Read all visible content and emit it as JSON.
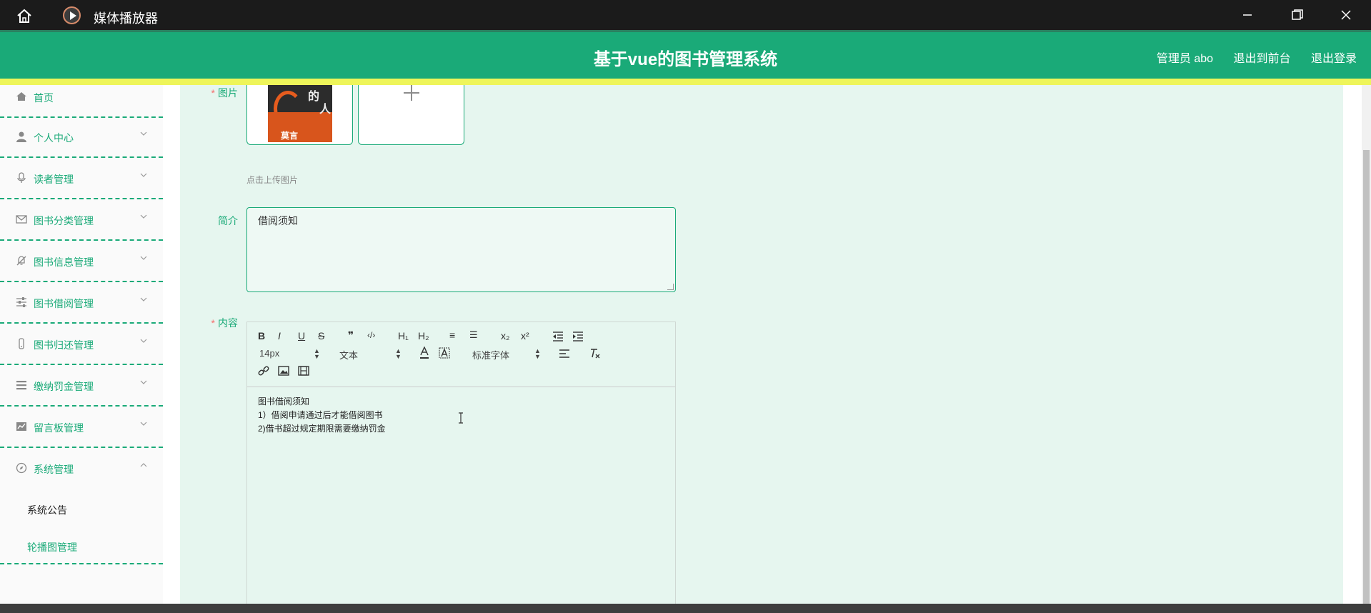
{
  "window": {
    "app_title": "媒体播放器",
    "icons": {
      "home": "home-icon",
      "app": "media-player-icon",
      "minimize": "minimize-icon",
      "maximize": "restore-icon",
      "close": "close-icon"
    }
  },
  "header": {
    "title": "基于vue的图书管理系统",
    "user": "管理员 abo",
    "to_front": "退出到前台",
    "logout": "退出登录",
    "colors": {
      "header_bg": "#1aaa78",
      "accent_strip": "#eef55a"
    }
  },
  "sidebar": {
    "items": [
      {
        "label": "首页",
        "icon": "home-icon"
      },
      {
        "label": "个人中心",
        "icon": "user-icon"
      },
      {
        "label": "读者管理",
        "icon": "microphone-icon"
      },
      {
        "label": "图书分类管理",
        "icon": "envelope-icon"
      },
      {
        "label": "图书信息管理",
        "icon": "bell-off-icon"
      },
      {
        "label": "图书借阅管理",
        "icon": "sliders-icon"
      },
      {
        "label": "图书归还管理",
        "icon": "phone-icon"
      },
      {
        "label": "缴纳罚金管理",
        "icon": "list-icon"
      },
      {
        "label": "留言板管理",
        "icon": "chart-icon"
      },
      {
        "label": "系统管理",
        "icon": "compass-icon"
      }
    ],
    "submenu": [
      {
        "label": "系统公告"
      },
      {
        "label": "轮播图管理"
      }
    ]
  },
  "form": {
    "image_label": "图片",
    "upload_tip": "点击上传图片",
    "cover_text": {
      "char1": "的",
      "char2": "人",
      "author": "莫言"
    },
    "intro_label": "简介",
    "intro_value": "借阅须知",
    "content_label": "内容",
    "required_mark": "*"
  },
  "editor": {
    "toolbar": {
      "bold": "B",
      "italic": "I",
      "underline": "U",
      "strike": "S",
      "quote": "❞",
      "code": "‹/›",
      "h1": "H₁",
      "h2": "H₂",
      "ordered_list": "≡",
      "bullet_list": "☰",
      "sub": "x₂",
      "sup": "x²",
      "size": "14px",
      "header": "文本",
      "font": "标准字体"
    },
    "content_lines": [
      "图书借阅须知",
      "1）借阅申请通过后才能借阅图书",
      "2)借书超过规定期限需要缴纳罚金"
    ]
  }
}
